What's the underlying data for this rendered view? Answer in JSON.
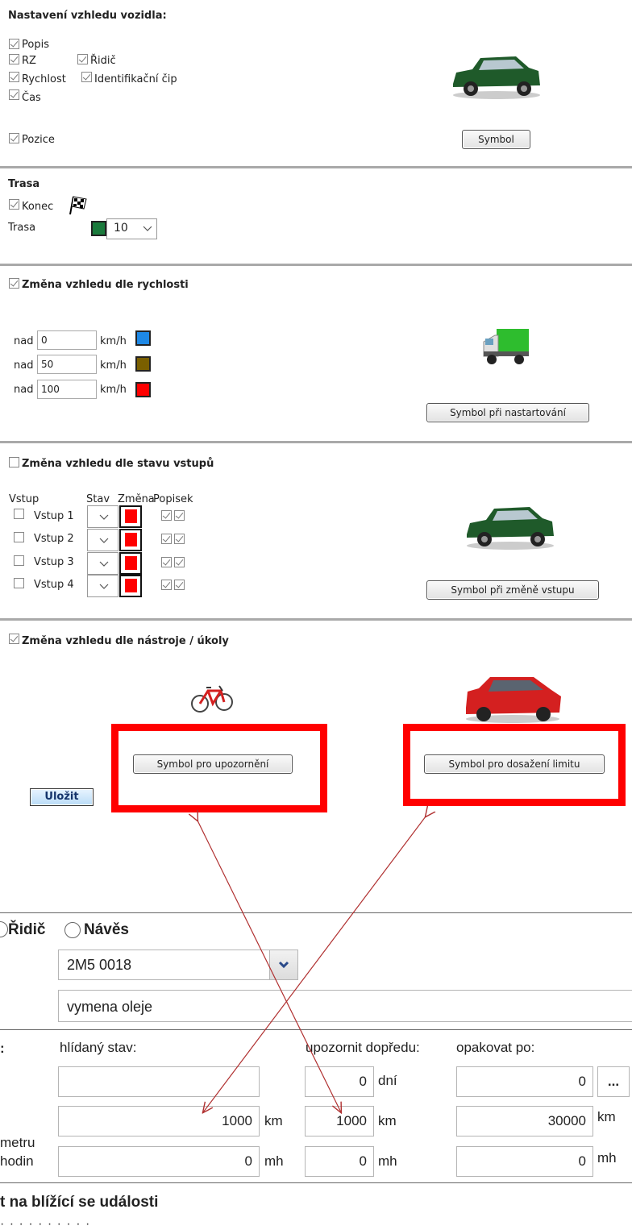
{
  "vehicle": {
    "title": "Nastavení vzhledu vozidla:",
    "opt_popis": "Popis",
    "opt_rz": "RZ",
    "opt_ridic": "Řidič",
    "opt_rychlost": "Rychlost",
    "opt_cip": "Identifikační čip",
    "opt_cas": "Čas",
    "opt_pozice": "Pozice",
    "symbol_button": "Symbol",
    "car_color": "#1f5a2a"
  },
  "route": {
    "title": "Trasa",
    "konec": "Konec",
    "trasa_label": "Trasa",
    "color": "#1a7a3c",
    "width_value": "10"
  },
  "speed": {
    "title": "Změna vzhledu dle rychlosti",
    "prefix": "nad",
    "unit": "km/h",
    "rows": [
      {
        "value": "0",
        "color": "#1e88e5"
      },
      {
        "value": "50",
        "color": "#7a5f00"
      },
      {
        "value": "100",
        "color": "#ff0000"
      }
    ],
    "button": "Symbol při nastartování",
    "truck_color": "#2ebd2e"
  },
  "inputs": {
    "title": "Změna vzhledu dle stavu vstupů",
    "col_vstup": "Vstup",
    "col_stav": "Stav",
    "col_zmena": "Změna",
    "col_popisek": "Popisek",
    "rows": [
      {
        "label": "Vstup 1"
      },
      {
        "label": "Vstup 2"
      },
      {
        "label": "Vstup 3"
      },
      {
        "label": "Vstup 4"
      }
    ],
    "change_color": "#ff0000",
    "button": "Symbol při změně vstupu"
  },
  "tool": {
    "title": "Změna vzhledu dle nástroje / úkoly",
    "button_warn": "Symbol pro upozornění",
    "button_limit": "Symbol pro dosažení limitu",
    "car_color": "#d42020",
    "highlight_color": "#ff0000"
  },
  "save_button": "Uložit",
  "lower": {
    "radio_ridic": "Řidič",
    "radio_naves": "Návěs",
    "vehicle_select": "2M5 0018",
    "task_name": "vymena oleje",
    "colon": ":",
    "h_stav": "hlídaný stav:",
    "h_dopredu": "upozornit dopředu:",
    "h_opakovat": "opakovat po:",
    "row1": {
      "label": "",
      "stav": "",
      "dopredu": "0",
      "dopredu_unit": "dní",
      "opakovat": "0",
      "dots": "..."
    },
    "row2": {
      "label": "metru",
      "stav": "1000",
      "stav_unit": "km",
      "dopredu": "1000",
      "dopredu_unit": "km",
      "opakovat": "30000",
      "opakovat_unit": "km"
    },
    "row3": {
      "label": "hodin",
      "stav": "0",
      "stav_unit": "mh",
      "dopredu": "0",
      "dopredu_unit": "mh",
      "opakovat": "0",
      "opakovat_unit": "mh"
    },
    "section_title": "t na blížící se události"
  },
  "arrow_color": "#b03030"
}
